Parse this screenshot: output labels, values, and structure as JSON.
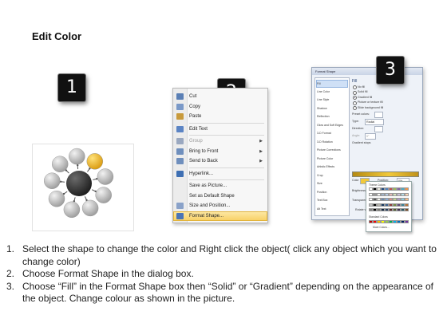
{
  "page": {
    "title": "Edit Color"
  },
  "steps": [
    "1",
    "2",
    "3"
  ],
  "diagram": {
    "center_color": "#2e2e2e",
    "node_color": "#b9b9b9",
    "selected_node_color": "#f0b81d",
    "node_count": 9
  },
  "context_menu": {
    "items": [
      {
        "label": "Cut",
        "icon": "scissors-icon",
        "dim": false,
        "arrow": false
      },
      {
        "label": "Copy",
        "icon": "copy-icon",
        "dim": false,
        "arrow": false
      },
      {
        "label": "Paste",
        "icon": "paste-icon",
        "dim": false,
        "arrow": false
      },
      {
        "label": "Edit Text",
        "icon": "edit-text-icon",
        "dim": false,
        "arrow": false,
        "sep_before": true
      },
      {
        "label": "Group",
        "icon": "group-icon",
        "dim": true,
        "arrow": true,
        "sep_before": true
      },
      {
        "label": "Bring to Front",
        "icon": "bring-front-icon",
        "dim": false,
        "arrow": true
      },
      {
        "label": "Send to Back",
        "icon": "send-back-icon",
        "dim": false,
        "arrow": true
      },
      {
        "label": "Hyperlink...",
        "icon": "hyperlink-icon",
        "dim": false,
        "arrow": false,
        "sep_before": true
      },
      {
        "label": "Save as Picture...",
        "icon": "",
        "dim": false,
        "arrow": false,
        "sep_before": true
      },
      {
        "label": "Set as Default Shape",
        "icon": "",
        "dim": false,
        "arrow": false
      },
      {
        "label": "Size and Position...",
        "icon": "size-icon",
        "dim": false,
        "arrow": false
      },
      {
        "label": "Format Shape...",
        "icon": "format-shape-icon",
        "dim": false,
        "arrow": false,
        "highlight": true
      }
    ]
  },
  "dialog": {
    "title": "Format Shape",
    "categories": [
      "Fill",
      "Line Color",
      "Line Style",
      "Shadow",
      "Reflection",
      "Glow and Soft Edges",
      "3-D Format",
      "3-D Rotation",
      "Picture Corrections",
      "Picture Color",
      "Artistic Effects",
      "Crop",
      "Size",
      "Position",
      "Text Box",
      "Alt Text"
    ],
    "selected_category": "Fill",
    "fill_heading": "Fill",
    "fill_options": [
      "No fill",
      "Solid fill",
      "Gradient fill",
      "Picture or texture fill",
      "Slide background fill"
    ],
    "selected_fill": "Gradient fill",
    "fields": {
      "preset_colors": "Preset colors:",
      "type": "Type:",
      "type_value": "Radial",
      "direction": "Direction:",
      "angle": "Angle:",
      "angle_value": "0°",
      "gradient_stops": "Gradient stops",
      "color": "Color",
      "position": "Position:",
      "position_value": "0%",
      "brightness": "Brightness",
      "transparency": "Transparency",
      "rotate": "Rotate with shape"
    },
    "palette": {
      "theme_label": "Theme Colors",
      "standard_label": "Standard Colors",
      "more_label": "More Colors...",
      "theme_colors": [
        "#ffffff",
        "#000000",
        "#eeece1",
        "#1f497d",
        "#4f81bd",
        "#c0504d",
        "#9bbb59",
        "#8064a2",
        "#4bacc6",
        "#f79646"
      ],
      "standard_colors": [
        "#c00000",
        "#ff0000",
        "#ffc000",
        "#ffff00",
        "#92d050",
        "#00b050",
        "#00b0f0",
        "#0070c0",
        "#002060",
        "#7030a0"
      ]
    }
  },
  "instructions": [
    {
      "num": "1.",
      "text": "Select the shape to change the color and Right click the object( click any object which you want to change color)"
    },
    {
      "num": "2.",
      "text": "Choose Format Shape in the dialog box."
    },
    {
      "num": "3.",
      "text": "Choose “Fill” in the Format Shape box then “Solid” or “Gradient” depending on the appearance of the object. Change colour as shown in the picture."
    }
  ]
}
